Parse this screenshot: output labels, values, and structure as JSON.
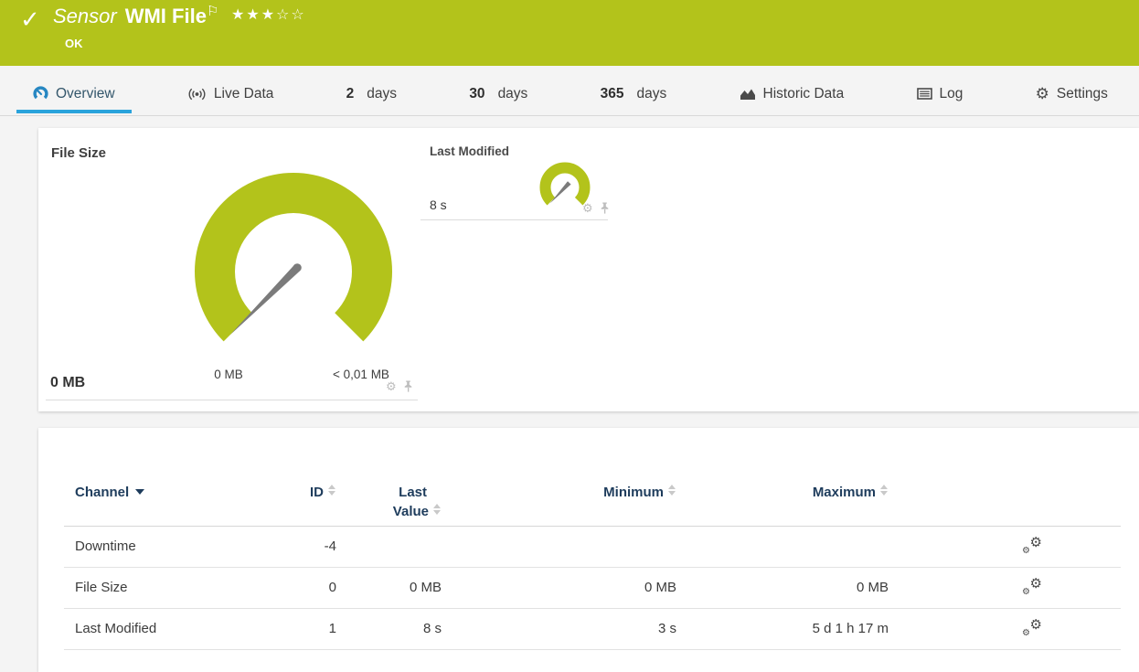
{
  "colors": {
    "brand_green": "#b3c31b",
    "accent_blue": "#2aa3dc",
    "table_header_navy": "#1e3c5c",
    "needle_gray": "#7b7b7b"
  },
  "icons": {
    "check": "✓",
    "flag": "⚐",
    "gear": "⚙",
    "stars": "★★★☆☆"
  },
  "header": {
    "type_label": "Sensor",
    "title": "WMI File",
    "status": "OK"
  },
  "tabs": {
    "overview": "Overview",
    "live_data": "Live Data",
    "d2_num": "2",
    "d2_label": "days",
    "d30_num": "30",
    "d30_label": "days",
    "d365_num": "365",
    "d365_label": "days",
    "historic": "Historic Data",
    "log": "Log",
    "settings": "Settings"
  },
  "overview": {
    "file_size": {
      "title": "File Size",
      "current": "0 MB",
      "scale_min": "0 MB",
      "scale_max": "< 0,01 MB"
    },
    "last_modified": {
      "title": "Last Modified",
      "current": "8 s"
    }
  },
  "channel_table": {
    "headers": {
      "channel": "Channel",
      "id": "ID",
      "last1": "Last",
      "last2": "Value",
      "min": "Minimum",
      "max": "Maximum"
    },
    "rows": [
      {
        "channel": "Downtime",
        "id": "-4",
        "last": "",
        "min": "",
        "max": ""
      },
      {
        "channel": "File Size",
        "id": "0",
        "last": "0 MB",
        "min": "0 MB",
        "max": "0 MB"
      },
      {
        "channel": "Last Modified",
        "id": "1",
        "last": "8 s",
        "min": "3 s",
        "max": "5 d 1 h 17 m"
      }
    ]
  }
}
